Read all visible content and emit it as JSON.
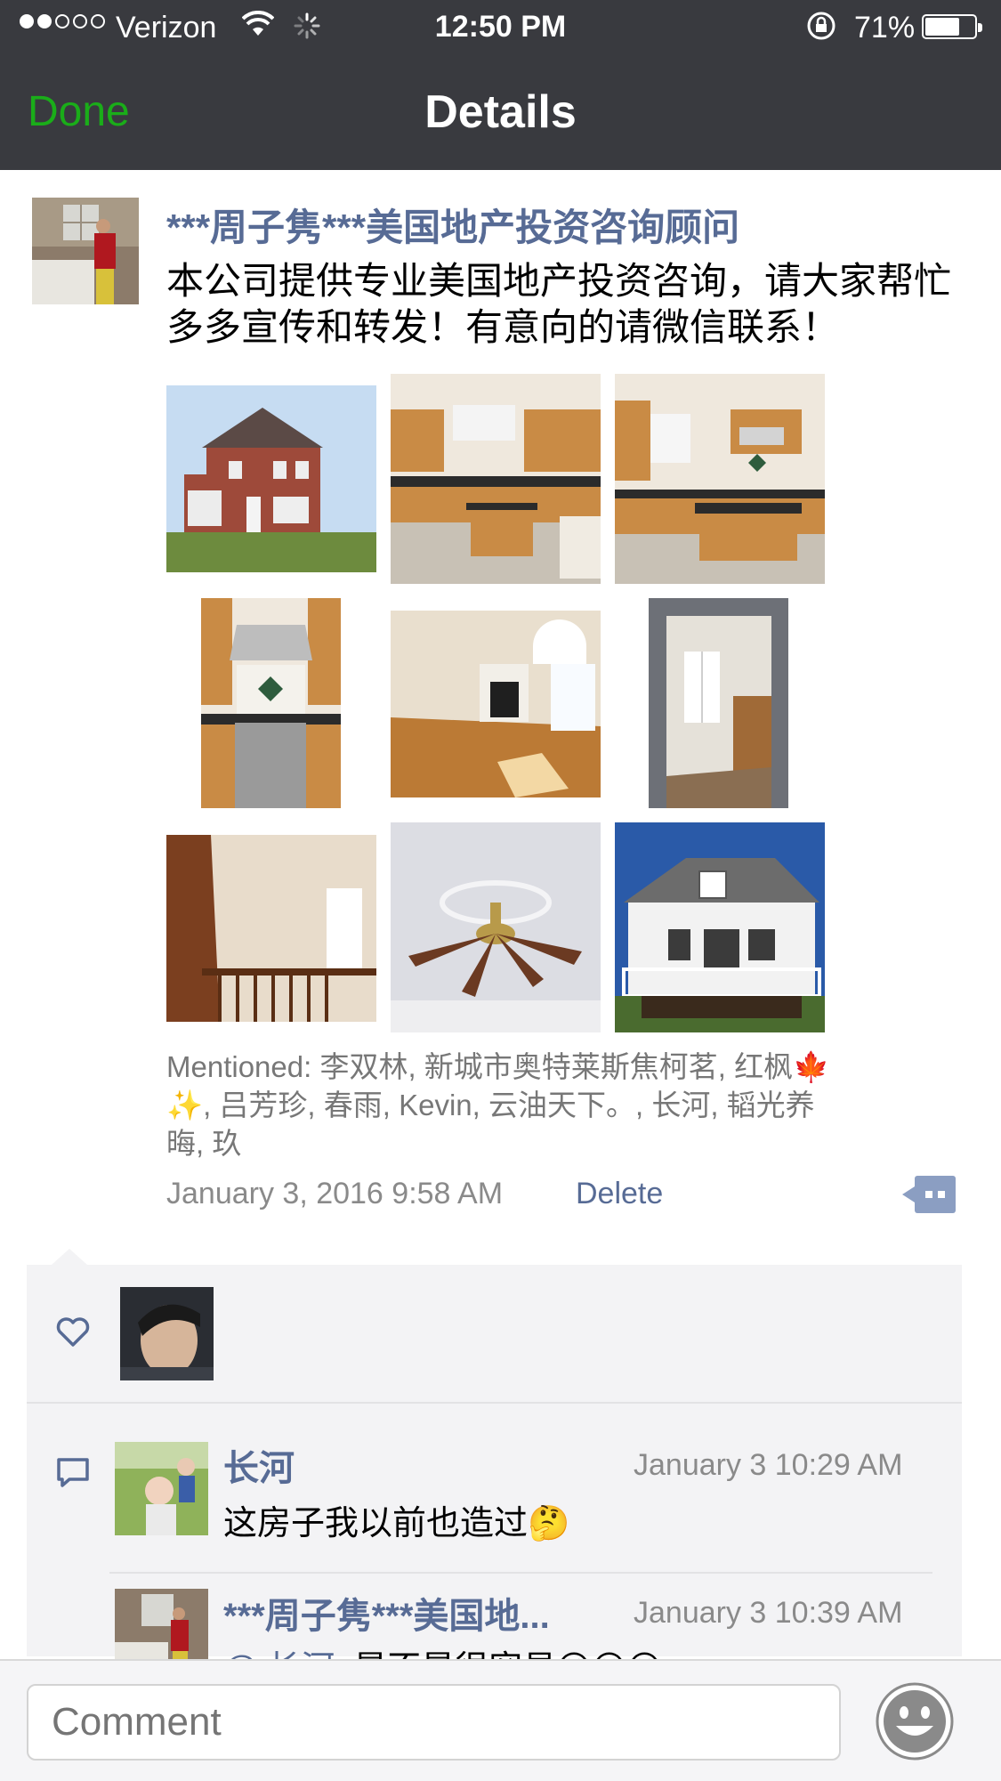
{
  "status_bar": {
    "carrier": "Verizon",
    "time": "12:50 PM",
    "battery": "71%",
    "battery_level": 0.71
  },
  "nav": {
    "done_label": "Done",
    "title": "Details"
  },
  "post": {
    "author": "***周子隽***美国地产投资咨询顾问",
    "text": "本公司提供专业美国地产投资咨询，请大家帮忙多多宣传和转发！有意向的请微信联系！",
    "photos": [
      "house-front",
      "kitchen-1",
      "kitchen-2",
      "range-hood",
      "living-room",
      "doorway",
      "staircase",
      "ceiling-fan",
      "house-back"
    ],
    "mentioned": "Mentioned: 李双林, 新城市奥特莱斯焦柯茗, 红枫🍁✨, 吕芳珍, 春雨, Kevin, 云油天下。, 长河, 韬光养晦, 玖",
    "timestamp": "January 3, 2016 9:58 AM",
    "delete_label": "Delete"
  },
  "comments": [
    {
      "name": "长河",
      "time": "January 3 10:29 AM",
      "text": "这房子我以前也造过🤔"
    },
    {
      "name": "***周子隽***美国地...",
      "time": "January 3 10:39 AM",
      "mention": "@ 长河",
      "text": ": 是不是很容易😊😊😊"
    }
  ],
  "comment_bar": {
    "placeholder": "Comment"
  },
  "colors": {
    "accent_green": "#1aad19",
    "link_blue": "#576b95",
    "nav_bg": "#393a3f"
  }
}
